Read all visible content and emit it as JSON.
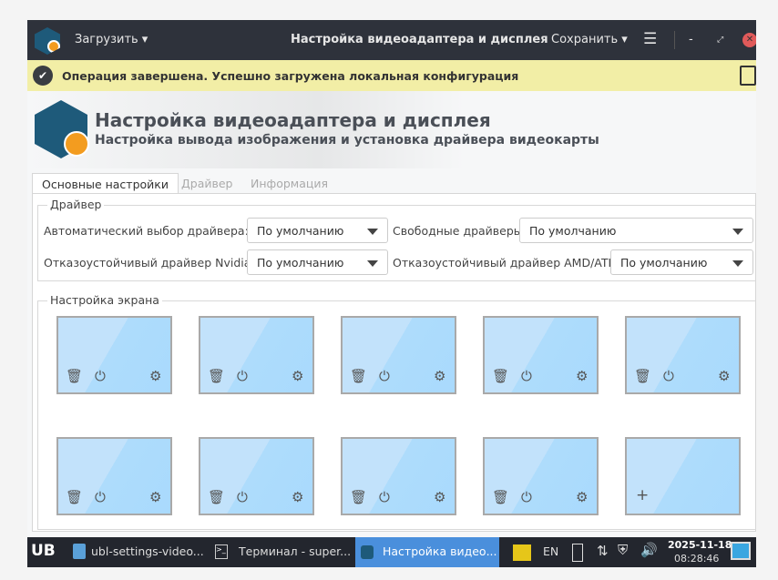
{
  "titlebar": {
    "load": "Загрузить",
    "title": "Настройка видеоадаптера и дисплея",
    "save": "Сохранить"
  },
  "info": {
    "message": "Операция завершена. Успешно загружена локальная конфигурация"
  },
  "header": {
    "title": "Настройка видеоадаптера и дисплея",
    "subtitle": "Настройка вывода изображения и установка драйвера видеокарты"
  },
  "tabs": [
    "Основные настройки",
    "Драйвер",
    "Информация"
  ],
  "driver": {
    "group": "Драйвер",
    "auto_label": "Автоматический выбор драйвера:",
    "auto_value": "По умолчанию",
    "free_label": "Свободные драйверы",
    "free_value": "По умолчанию",
    "nvidia_label": "Отказоустойчивый драйвер Nvidia:",
    "nvidia_value": "По умолчанию",
    "amd_label": "Отказоустойчивый драйвер AMD/ATI:",
    "amd_value": "По умолчанию"
  },
  "screen": {
    "group": "Настройка экрана",
    "monitor_count": 9,
    "add_symbol": "+"
  },
  "taskbar": {
    "logo": "UB",
    "items": [
      "ubl-settings-video...",
      "Терминал - super...",
      "Настройка видео..."
    ],
    "lang": "EN",
    "date": "2025-11-18",
    "time": "08:28:46"
  }
}
